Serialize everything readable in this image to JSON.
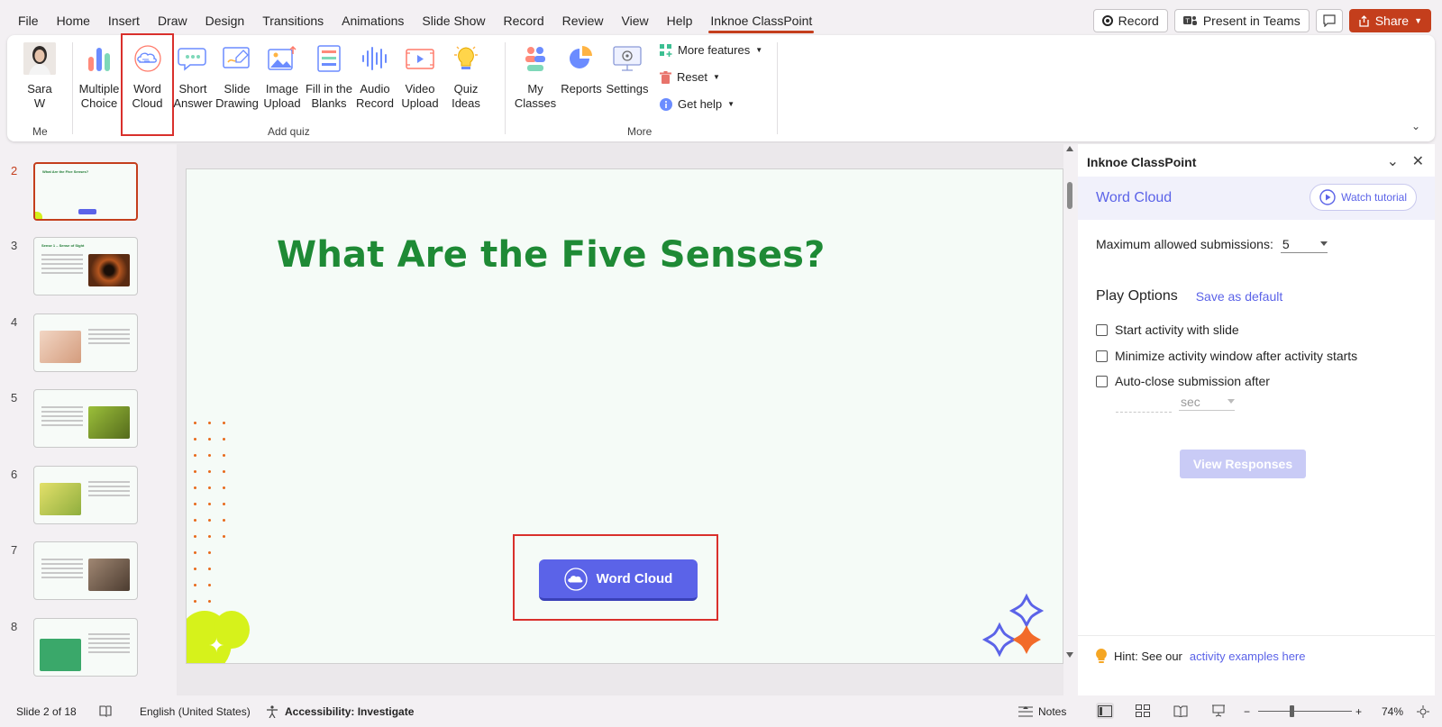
{
  "menu": {
    "tabs": [
      "File",
      "Home",
      "Insert",
      "Draw",
      "Design",
      "Transitions",
      "Animations",
      "Slide Show",
      "Record",
      "Review",
      "View",
      "Help",
      "Inknoe ClassPoint"
    ],
    "active_tab": "Inknoe ClassPoint",
    "record": "Record",
    "present_teams": "Present in Teams",
    "share": "Share"
  },
  "ribbon": {
    "me": {
      "user": "Sara\nW",
      "group": "Me"
    },
    "addquiz": [
      {
        "label": "Multiple\nChoice",
        "icon": "multiple-choice-icon"
      },
      {
        "label": "Word\nCloud",
        "icon": "word-cloud-icon"
      },
      {
        "label": "Short\nAnswer",
        "icon": "short-answer-icon"
      },
      {
        "label": "Slide\nDrawing",
        "icon": "slide-drawing-icon"
      },
      {
        "label": "Image\nUpload",
        "icon": "image-upload-icon"
      },
      {
        "label": "Fill in the\nBlanks",
        "icon": "fill-blanks-icon"
      },
      {
        "label": "Audio\nRecord",
        "icon": "audio-record-icon"
      },
      {
        "label": "Video\nUpload",
        "icon": "video-upload-icon"
      },
      {
        "label": "Quiz\nIdeas",
        "icon": "quiz-ideas-icon"
      }
    ],
    "addquiz_group": "Add quiz",
    "more": [
      {
        "label": "My\nClasses",
        "icon": "my-classes-icon"
      },
      {
        "label": "Reports",
        "icon": "reports-icon"
      },
      {
        "label": "Settings",
        "icon": "settings-icon"
      }
    ],
    "more_small": [
      "More features",
      "Reset",
      "Get help"
    ],
    "more_group": "More"
  },
  "thumbnails": [
    {
      "num": "2",
      "title": "What Are the Five Senses?",
      "selected": true
    },
    {
      "num": "3",
      "title": "Sense 1 – Sense of Sight"
    },
    {
      "num": "4",
      "title": ""
    },
    {
      "num": "5",
      "title": ""
    },
    {
      "num": "6",
      "title": ""
    },
    {
      "num": "7",
      "title": ""
    },
    {
      "num": "8",
      "title": ""
    }
  ],
  "slide": {
    "title": "What Are the Five Senses?",
    "button_label": "Word Cloud"
  },
  "pane": {
    "header": "Inknoe ClassPoint",
    "activity": "Word Cloud",
    "tutorial": "Watch tutorial",
    "max_label": "Maximum allowed submissions:",
    "max_value": "5",
    "play_options": "Play Options",
    "save_default": "Save as default",
    "opt1": "Start activity with slide",
    "opt2": "Minimize activity window after activity starts",
    "opt3": "Auto-close submission after",
    "sec": "sec",
    "view_responses": "View Responses",
    "hint_prefix": "Hint: See our",
    "hint_link": "activity examples here"
  },
  "status": {
    "slide": "Slide 2 of 18",
    "language": "English (United States)",
    "accessibility": "Accessibility: Investigate",
    "notes": "Notes",
    "zoom": "74%"
  },
  "colors": {
    "accent": "#c43e1c",
    "classpoint": "#5b63e8",
    "title_green": "#1e8a35"
  }
}
